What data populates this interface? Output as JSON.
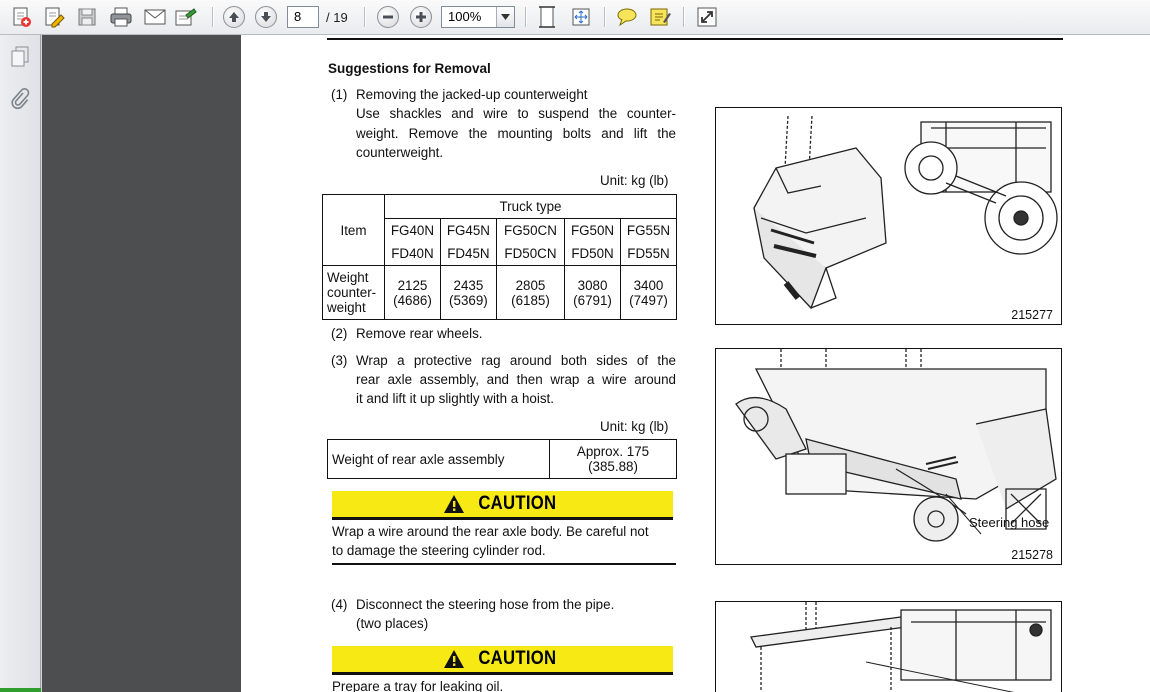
{
  "toolbar": {
    "current_page": "8",
    "page_total": "/ 19",
    "zoom": "100%",
    "buttons": [
      "create-pdf",
      "edit",
      "save",
      "print",
      "email",
      "export",
      "prev-page",
      "next-page",
      "zoom-out",
      "zoom-in",
      "fit-page",
      "fit-width",
      "comment",
      "highlight",
      "full-screen"
    ]
  },
  "document": {
    "section_title": "Suggestions for Removal",
    "steps": [
      {
        "num": "(1)",
        "title": "Removing the jacked-up counterweight",
        "body": [
          "Use shackles and wire to suspend the counter-",
          "weight. Remove the mounting bolts and lift the",
          "counterweight."
        ]
      },
      {
        "num": "(2)",
        "title": "Remove rear wheels."
      },
      {
        "num": "(3)",
        "body": [
          "Wrap a protective rag around both sides of the",
          "rear axle assembly, and then wrap a wire around",
          "it and lift it up slightly with a hoist."
        ]
      },
      {
        "num": "(4)",
        "body": [
          "Disconnect the steering hose from the pipe.",
          "(two places)"
        ]
      }
    ],
    "unit_label": "Unit: kg (lb)",
    "weight_table": {
      "item_label": "Item",
      "truck_type_label": "Truck type",
      "models_top": [
        "FG40N",
        "FG45N",
        "FG50CN",
        "FG50N",
        "FG55N"
      ],
      "models_bottom": [
        "FD40N",
        "FD45N",
        "FD50CN",
        "FD50N",
        "FD55N"
      ],
      "row_label": [
        "Weight",
        "counter-",
        "weight"
      ],
      "kg": [
        "2125",
        "2435",
        "2805",
        "3080",
        "3400"
      ],
      "lb": [
        "(4686)",
        "(5369)",
        "(6185)",
        "(6791)",
        "(7497)"
      ]
    },
    "axle_table": {
      "label": "Weight of rear axle assembly",
      "value_line1": "Approx. 175",
      "value_line2": "(385.88)"
    },
    "caution_label": "CAUTION",
    "caution1_text": [
      "Wrap a wire around the rear axle body. Be careful not",
      "to damage the steering cylinder rod."
    ],
    "caution2_text": "Prepare a tray for leaking oil.",
    "figures": [
      {
        "number": "215277"
      },
      {
        "number": "215278",
        "callout": "Steering hose"
      }
    ]
  },
  "colors": {
    "caution_yellow": "#f7ea14",
    "viewer_bg": "#4c4e50"
  }
}
